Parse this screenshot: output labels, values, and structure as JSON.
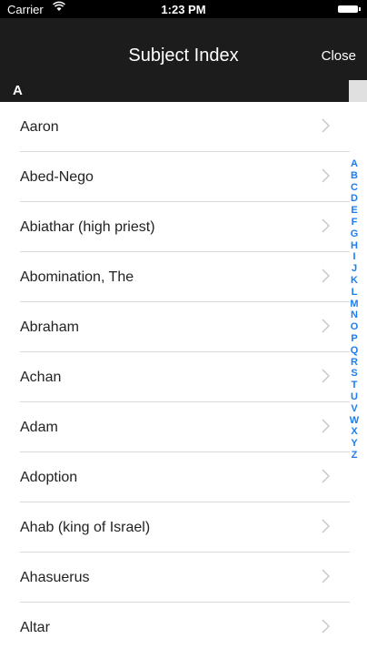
{
  "status_bar": {
    "carrier": "Carrier",
    "time": "1:23 PM"
  },
  "nav_bar": {
    "title": "Subject Index",
    "close_label": "Close"
  },
  "section_header": {
    "letter": "A"
  },
  "list": {
    "items": [
      "Aaron",
      "Abed-Nego",
      "Abiathar (high priest)",
      "Abomination, The",
      "Abraham",
      "Achan",
      "Adam",
      "Adoption",
      "Ahab (king of Israel)",
      "Ahasuerus",
      "Altar"
    ]
  },
  "index_bar": {
    "letters": [
      "A",
      "B",
      "C",
      "D",
      "E",
      "F",
      "G",
      "H",
      "I",
      "J",
      "K",
      "L",
      "M",
      "N",
      "O",
      "P",
      "Q",
      "R",
      "S",
      "T",
      "U",
      "V",
      "W",
      "X",
      "Y",
      "Z"
    ],
    "color": "#1a7ef2"
  },
  "icons": {
    "wifi": "wifi-icon",
    "battery": "battery-icon",
    "chevron": "chevron-right-icon"
  }
}
